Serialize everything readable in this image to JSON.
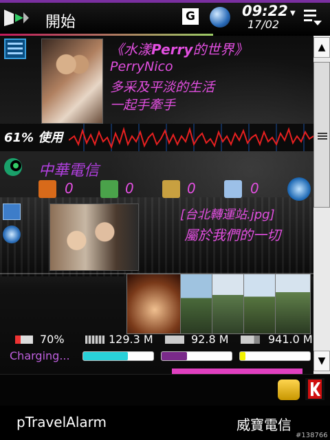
{
  "titlebar": {
    "title": "開始",
    "time": "09:22",
    "date": "17/02",
    "g_label": "G"
  },
  "blog": {
    "title_prefix": "《水漾",
    "title_bold": "Perry",
    "title_suffix": "的世界》",
    "line1": "PerryNico",
    "line2": "多采及平淡的生活",
    "line3": "一起手牽手"
  },
  "cpu": {
    "percent": "61%",
    "label": "使用",
    "value": 0.61
  },
  "carrier": {
    "name": "中華電信"
  },
  "counters": [
    {
      "icon": "missed-call-icon",
      "value": "0"
    },
    {
      "icon": "sms-icon",
      "value": "0"
    },
    {
      "icon": "mms-icon",
      "value": "0"
    },
    {
      "icon": "email-icon",
      "value": "0"
    }
  ],
  "album": {
    "name": "[台北轉運站.jpg]",
    "description": "屬於我們的一切"
  },
  "stats": {
    "battery": {
      "text": "70%",
      "value": 0.7
    },
    "storage1": {
      "text": "129.3 M",
      "value": 0.64
    },
    "storage2": {
      "text": "92.8 M",
      "value": 0.36
    },
    "storage3": {
      "text": "941.0 M",
      "value": 0.08
    },
    "charging_text": "Charging..."
  },
  "colors": {
    "accent": "#e24fe0",
    "carrier": "#b240e0",
    "bar1": "#29d1d9",
    "bar2": "#7a2a8a",
    "bar3": "#f2f200"
  },
  "softkeys": {
    "left": "pTravelAlarm",
    "right": "威寶電信"
  },
  "photo_id": "#138766"
}
